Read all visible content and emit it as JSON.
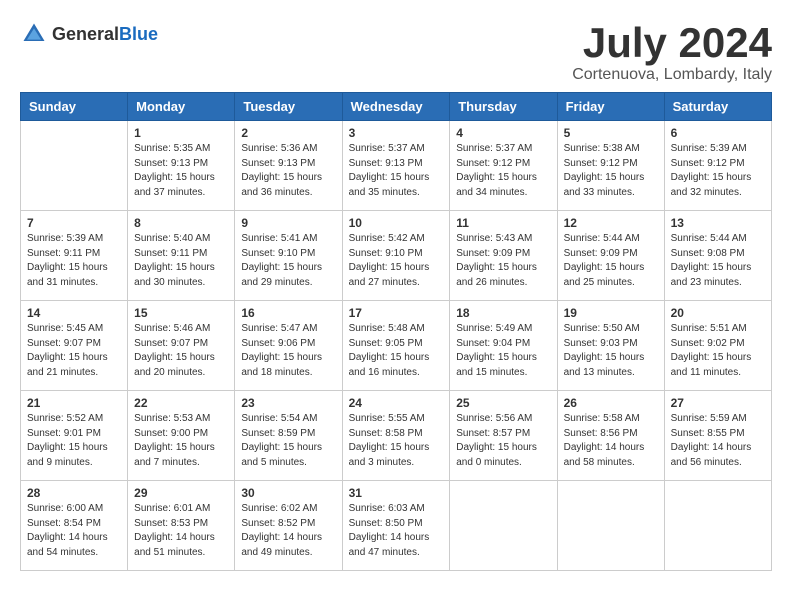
{
  "header": {
    "logo_general": "General",
    "logo_blue": "Blue",
    "month_year": "July 2024",
    "location": "Cortenuova, Lombardy, Italy"
  },
  "weekdays": [
    "Sunday",
    "Monday",
    "Tuesday",
    "Wednesday",
    "Thursday",
    "Friday",
    "Saturday"
  ],
  "weeks": [
    [
      {
        "day": "",
        "sunrise": "",
        "sunset": "",
        "daylight": ""
      },
      {
        "day": "1",
        "sunrise": "Sunrise: 5:35 AM",
        "sunset": "Sunset: 9:13 PM",
        "daylight": "Daylight: 15 hours and 37 minutes."
      },
      {
        "day": "2",
        "sunrise": "Sunrise: 5:36 AM",
        "sunset": "Sunset: 9:13 PM",
        "daylight": "Daylight: 15 hours and 36 minutes."
      },
      {
        "day": "3",
        "sunrise": "Sunrise: 5:37 AM",
        "sunset": "Sunset: 9:13 PM",
        "daylight": "Daylight: 15 hours and 35 minutes."
      },
      {
        "day": "4",
        "sunrise": "Sunrise: 5:37 AM",
        "sunset": "Sunset: 9:12 PM",
        "daylight": "Daylight: 15 hours and 34 minutes."
      },
      {
        "day": "5",
        "sunrise": "Sunrise: 5:38 AM",
        "sunset": "Sunset: 9:12 PM",
        "daylight": "Daylight: 15 hours and 33 minutes."
      },
      {
        "day": "6",
        "sunrise": "Sunrise: 5:39 AM",
        "sunset": "Sunset: 9:12 PM",
        "daylight": "Daylight: 15 hours and 32 minutes."
      }
    ],
    [
      {
        "day": "7",
        "sunrise": "Sunrise: 5:39 AM",
        "sunset": "Sunset: 9:11 PM",
        "daylight": "Daylight: 15 hours and 31 minutes."
      },
      {
        "day": "8",
        "sunrise": "Sunrise: 5:40 AM",
        "sunset": "Sunset: 9:11 PM",
        "daylight": "Daylight: 15 hours and 30 minutes."
      },
      {
        "day": "9",
        "sunrise": "Sunrise: 5:41 AM",
        "sunset": "Sunset: 9:10 PM",
        "daylight": "Daylight: 15 hours and 29 minutes."
      },
      {
        "day": "10",
        "sunrise": "Sunrise: 5:42 AM",
        "sunset": "Sunset: 9:10 PM",
        "daylight": "Daylight: 15 hours and 27 minutes."
      },
      {
        "day": "11",
        "sunrise": "Sunrise: 5:43 AM",
        "sunset": "Sunset: 9:09 PM",
        "daylight": "Daylight: 15 hours and 26 minutes."
      },
      {
        "day": "12",
        "sunrise": "Sunrise: 5:44 AM",
        "sunset": "Sunset: 9:09 PM",
        "daylight": "Daylight: 15 hours and 25 minutes."
      },
      {
        "day": "13",
        "sunrise": "Sunrise: 5:44 AM",
        "sunset": "Sunset: 9:08 PM",
        "daylight": "Daylight: 15 hours and 23 minutes."
      }
    ],
    [
      {
        "day": "14",
        "sunrise": "Sunrise: 5:45 AM",
        "sunset": "Sunset: 9:07 PM",
        "daylight": "Daylight: 15 hours and 21 minutes."
      },
      {
        "day": "15",
        "sunrise": "Sunrise: 5:46 AM",
        "sunset": "Sunset: 9:07 PM",
        "daylight": "Daylight: 15 hours and 20 minutes."
      },
      {
        "day": "16",
        "sunrise": "Sunrise: 5:47 AM",
        "sunset": "Sunset: 9:06 PM",
        "daylight": "Daylight: 15 hours and 18 minutes."
      },
      {
        "day": "17",
        "sunrise": "Sunrise: 5:48 AM",
        "sunset": "Sunset: 9:05 PM",
        "daylight": "Daylight: 15 hours and 16 minutes."
      },
      {
        "day": "18",
        "sunrise": "Sunrise: 5:49 AM",
        "sunset": "Sunset: 9:04 PM",
        "daylight": "Daylight: 15 hours and 15 minutes."
      },
      {
        "day": "19",
        "sunrise": "Sunrise: 5:50 AM",
        "sunset": "Sunset: 9:03 PM",
        "daylight": "Daylight: 15 hours and 13 minutes."
      },
      {
        "day": "20",
        "sunrise": "Sunrise: 5:51 AM",
        "sunset": "Sunset: 9:02 PM",
        "daylight": "Daylight: 15 hours and 11 minutes."
      }
    ],
    [
      {
        "day": "21",
        "sunrise": "Sunrise: 5:52 AM",
        "sunset": "Sunset: 9:01 PM",
        "daylight": "Daylight: 15 hours and 9 minutes."
      },
      {
        "day": "22",
        "sunrise": "Sunrise: 5:53 AM",
        "sunset": "Sunset: 9:00 PM",
        "daylight": "Daylight: 15 hours and 7 minutes."
      },
      {
        "day": "23",
        "sunrise": "Sunrise: 5:54 AM",
        "sunset": "Sunset: 8:59 PM",
        "daylight": "Daylight: 15 hours and 5 minutes."
      },
      {
        "day": "24",
        "sunrise": "Sunrise: 5:55 AM",
        "sunset": "Sunset: 8:58 PM",
        "daylight": "Daylight: 15 hours and 3 minutes."
      },
      {
        "day": "25",
        "sunrise": "Sunrise: 5:56 AM",
        "sunset": "Sunset: 8:57 PM",
        "daylight": "Daylight: 15 hours and 0 minutes."
      },
      {
        "day": "26",
        "sunrise": "Sunrise: 5:58 AM",
        "sunset": "Sunset: 8:56 PM",
        "daylight": "Daylight: 14 hours and 58 minutes."
      },
      {
        "day": "27",
        "sunrise": "Sunrise: 5:59 AM",
        "sunset": "Sunset: 8:55 PM",
        "daylight": "Daylight: 14 hours and 56 minutes."
      }
    ],
    [
      {
        "day": "28",
        "sunrise": "Sunrise: 6:00 AM",
        "sunset": "Sunset: 8:54 PM",
        "daylight": "Daylight: 14 hours and 54 minutes."
      },
      {
        "day": "29",
        "sunrise": "Sunrise: 6:01 AM",
        "sunset": "Sunset: 8:53 PM",
        "daylight": "Daylight: 14 hours and 51 minutes."
      },
      {
        "day": "30",
        "sunrise": "Sunrise: 6:02 AM",
        "sunset": "Sunset: 8:52 PM",
        "daylight": "Daylight: 14 hours and 49 minutes."
      },
      {
        "day": "31",
        "sunrise": "Sunrise: 6:03 AM",
        "sunset": "Sunset: 8:50 PM",
        "daylight": "Daylight: 14 hours and 47 minutes."
      },
      {
        "day": "",
        "sunrise": "",
        "sunset": "",
        "daylight": ""
      },
      {
        "day": "",
        "sunrise": "",
        "sunset": "",
        "daylight": ""
      },
      {
        "day": "",
        "sunrise": "",
        "sunset": "",
        "daylight": ""
      }
    ]
  ]
}
